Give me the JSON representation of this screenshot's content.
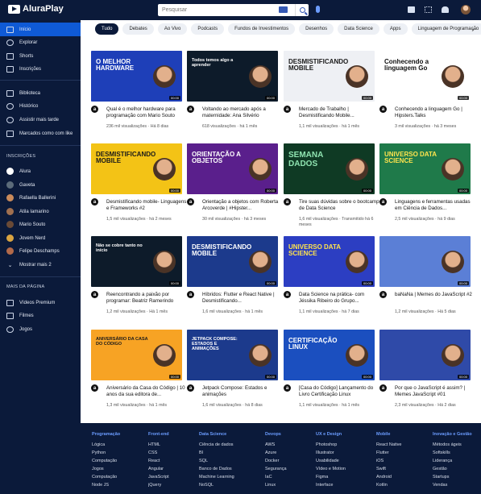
{
  "brand": {
    "name": "AluraPlay"
  },
  "search": {
    "placeholder": "Pesquisar"
  },
  "sidebar": {
    "main": [
      {
        "label": "Início",
        "icon": "home-icon",
        "active": true
      },
      {
        "label": "Explorar",
        "icon": "compass-icon"
      },
      {
        "label": "Shorts",
        "icon": "shorts-icon"
      },
      {
        "label": "Inscrições",
        "icon": "subscriptions-icon"
      }
    ],
    "library": [
      {
        "label": "Biblioteca",
        "icon": "library-icon"
      },
      {
        "label": "Histórico",
        "icon": "history-icon"
      },
      {
        "label": "Assistir mais tarde",
        "icon": "clock-icon"
      },
      {
        "label": "Marcados como com like",
        "icon": "thumb-up-icon"
      }
    ],
    "subs_heading": "INSCRIÇÕES",
    "subs": [
      {
        "label": "Alura",
        "color": "#111111"
      },
      {
        "label": "Gaveta",
        "color": "#5b6b7a"
      },
      {
        "label": "Rafaella Ballerini",
        "color": "#c98a5b"
      },
      {
        "label": "Atila Iamarino",
        "color": "#a07050"
      },
      {
        "label": "Mario Souto",
        "color": "#6a4a36"
      },
      {
        "label": "Jovem Nerd",
        "color": "#d9a441"
      },
      {
        "label": "Felipe Deschamps",
        "color": "#b26a4a"
      }
    ],
    "show_more": "Mostrar mais 2",
    "more_heading": "MAIS DA PÁGINA",
    "more": [
      {
        "label": "Vídeos Premium",
        "icon": "play-box-icon"
      },
      {
        "label": "Filmes",
        "icon": "film-icon"
      },
      {
        "label": "Jogos",
        "icon": "gamepad-icon"
      }
    ]
  },
  "chips": [
    "Tudo",
    "Debates",
    "Ao Vivo",
    "Podcasts",
    "Fundos de Investimentos",
    "Desenhos",
    "Data Science",
    "Apps",
    "Linguagem de Programação"
  ],
  "videos": [
    {
      "title": "Qual é o melhor hardware para programação com Mario Souto",
      "views": "236 mil visualizações",
      "age": "Há 8 dias",
      "thumb_text": "O MELHOR HARDWARE",
      "bg": "#1e3fb8",
      "fg": "#ffffff",
      "duration": "00:00"
    },
    {
      "title": "Voltando ao mercado após a maternidade: Ana Silvério",
      "views": "618 visualizações",
      "age": "há 1 mês",
      "thumb_text": "Todos temos algo a aprender",
      "bg": "#0d1b2a",
      "fg": "#ffffff",
      "duration": "00:00"
    },
    {
      "title": "Mercado de Trabalho | Desmistificando Mobile...",
      "views": "1,1 mil visualizações",
      "age": "há 1 mês",
      "thumb_text": "DESMISTIFICANDO MOBILE",
      "bg": "#eef0f4",
      "fg": "#1a1a1a",
      "duration": "00:00"
    },
    {
      "title": "Conhecendo a linguagem Go | Hipsters.Talks",
      "views": "3 mil visualizações",
      "age": "há 3 meses",
      "thumb_text": "Conhecendo a linguagem Go",
      "bg": "#ffffff",
      "fg": "#111111",
      "duration": "00:00"
    },
    {
      "title": "Desmistificando mobile- Linguagens e Frameworks #2",
      "views": "1,5 mil visualizações",
      "age": "há 2 meses",
      "thumb_text": "DESMISTIFICANDO MOBILE",
      "bg": "#f3c316",
      "fg": "#1a1a1a",
      "duration": "00:00"
    },
    {
      "title": "Orientação a objetos com Roberta Arcoverde | #Hipster...",
      "views": "30 mil visualizações",
      "age": "há 3 meses",
      "thumb_text": "ORIENTAÇÃO A OBJETOS",
      "bg": "#5a1f8c",
      "fg": "#ffffff",
      "duration": "00:00"
    },
    {
      "title": "Tire suas dúvidas sobre o bootcamp de Data Science",
      "views": "1,6 mil visualizações · Transmitido há 6 meses",
      "age": "",
      "thumb_text": "SEMANA DADOS",
      "bg": "#0f3a24",
      "fg": "#8fe3b0",
      "duration": "00:00"
    },
    {
      "title": "Linguagens e ferramentas usadas em Ciência de Dados...",
      "views": "2,5 mil visualizações",
      "age": "há 9 dias",
      "thumb_text": "UNIVERSO DATA SCIENCE",
      "bg": "#1f7a4a",
      "fg": "#ffe44d",
      "duration": "00:00"
    },
    {
      "title": "Reencontrando a paixão por programar: Beatriz Ramerindo",
      "views": "1,2 mil visualizações",
      "age": "Há 1 mês",
      "thumb_text": "Não se cobre tanto no início",
      "bg": "#0d1b2a",
      "fg": "#ffffff",
      "duration": "00:00"
    },
    {
      "title": "Híbridos: Flutter e React Native | Desmistificando...",
      "views": "1,6 mil visualizações",
      "age": "há 1 mês",
      "thumb_text": "DESMISTIFICANDO MOBILE",
      "bg": "#1c3a8c",
      "fg": "#ffffff",
      "duration": "00:00"
    },
    {
      "title": "Data Science na prática- com Jéssika Ribeiro do Grupo...",
      "views": "1,1 mil visualizações",
      "age": "há 7 dias",
      "thumb_text": "UNIVERSO DATA SCIENCE",
      "bg": "#2c3ec2",
      "fg": "#ffe44d",
      "duration": "00:00"
    },
    {
      "title": "baNaNa | Memes do JavaScript #2",
      "views": "1,2 mil visualizações",
      "age": "Há 5 dias",
      "thumb_text": "",
      "bg": "#5b7fd6",
      "fg": "#ffffff",
      "duration": "00:00"
    },
    {
      "title": "Aniversário da Casa do Código | 10 anos da sua editora de...",
      "views": "1,3 mil visualizações",
      "age": "há 1 mês",
      "thumb_text": "ANIVERSÁRIO DA CASA DO CÓDIGO",
      "bg": "#f7a324",
      "fg": "#1a1a1a",
      "duration": "00:00"
    },
    {
      "title": "Jetpack Compose: Estados e animações",
      "views": "1,6 mil visualizações",
      "age": "há 8 dias",
      "thumb_text": "JETPACK COMPOSE: ESTADOS E ANIMAÇÕES",
      "bg": "#1c3a8c",
      "fg": "#ffffff",
      "duration": "00:00"
    },
    {
      "title": "[Casa do Código] Lançamento do Livro Certificação Linux",
      "views": "1,1 mil visualizações",
      "age": "há 1 mês",
      "thumb_text": "CERTIFICAÇÃO LINUX",
      "bg": "#1b4fbf",
      "fg": "#ffffff",
      "duration": "00:00"
    },
    {
      "title": "Por que o JavaScript é assim? | Memes JavaScript #01",
      "views": "2,3 mil visualizações",
      "age": "Há 2 dias",
      "thumb_text": "",
      "bg": "#2f4aa8",
      "fg": "#ffffff",
      "duration": "00:00"
    }
  ],
  "footer": [
    {
      "head": "Programação",
      "links": [
        "Lógica",
        "Python",
        "Computação",
        "Jogos",
        "Computação",
        "Node JS"
      ]
    },
    {
      "head": "Front-end",
      "links": [
        "HTML",
        "CSS",
        "React",
        "Angular",
        "JavaScript",
        "jQuery"
      ]
    },
    {
      "head": "Data Science",
      "links": [
        "Ciência de dados",
        "BI",
        "SQL",
        "Banco de Dados",
        "Machine Learning",
        "NoSQL"
      ]
    },
    {
      "head": "Devops",
      "links": [
        "AWS",
        "Azure",
        "Docker",
        "Segurança",
        "IaC",
        "Linux"
      ]
    },
    {
      "head": "UX e Design",
      "links": [
        "Photoshop",
        "Illustrator",
        "Usabilidade",
        "Vídeo e Motion",
        "Figma",
        "Interface"
      ]
    },
    {
      "head": "Mobile",
      "links": [
        "React Native",
        "Flutter",
        "iOS",
        "Swift",
        "Android",
        "Kotlin"
      ]
    },
    {
      "head": "Inovação e Gestão",
      "links": [
        "Métodos ágeis",
        "Softskills",
        "Liderança",
        "Gestão",
        "Startups",
        "Vendas"
      ]
    }
  ]
}
